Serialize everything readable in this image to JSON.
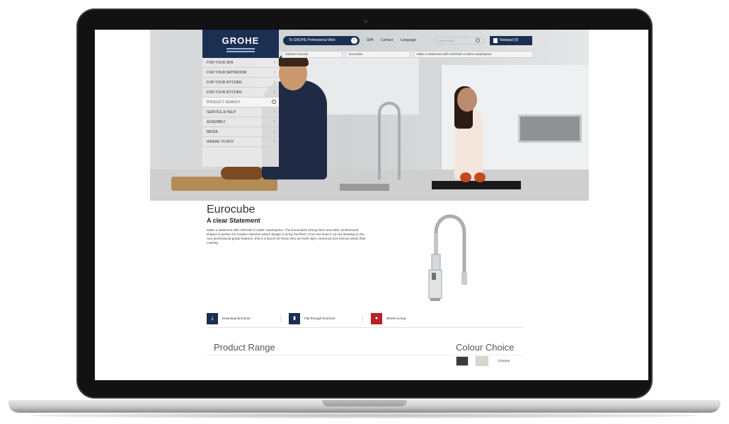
{
  "brand": {
    "logo_text": "GROHE",
    "color": "#1b2f52",
    "accent_red": "#b82127"
  },
  "menu": {
    "items": [
      "FOR YOUR SPA",
      "FOR YOUR BATHROOM",
      "FOR YOUR KITCHEN",
      "FOR YOUR KITCHEN"
    ],
    "search_placeholder": "PRODUCT SEARCH",
    "extra_items": [
      "SERVICE & HELP",
      "ASSEMBLY",
      "MEDIA",
      "WHERE TO BUY"
    ]
  },
  "top_nav": {
    "pro_button": "To GROHE Professional Web",
    "links": [
      "SPA",
      "Contact",
      "Language"
    ],
    "search_placeholder": "Search term",
    "notepad_label": "Notepad (0)"
  },
  "breadcrumbs": [
    "Kitchen Faucets",
    "Eurocube",
    "Make a statement with GROHE's Cubist masterpiece"
  ],
  "product": {
    "name": "Eurocube",
    "tagline": "A clear Statement",
    "description": "Make a statement with GROHE's Cubist masterpiece. The Eurocube's strong lines and solid, architectural shapes is perfect for modern kitchens where design is at the forefront. From the lever's cut-out detailing to the new professional grade features, this is a faucet for those who are both style conscious and serious about their cooking."
  },
  "actions": [
    {
      "label": "Download brochure",
      "icon": "pdf-icon"
    },
    {
      "label": "Flip through brochure",
      "icon": "book-icon"
    },
    {
      "label": "Where to buy",
      "icon": "location-pin-icon"
    }
  ],
  "sections": {
    "product_range": "Product Range",
    "colour_choice": "Colour Choice"
  },
  "colour": {
    "label": "Chrome",
    "swatches": [
      "#3a3a3a",
      "#d9d6cf"
    ]
  }
}
